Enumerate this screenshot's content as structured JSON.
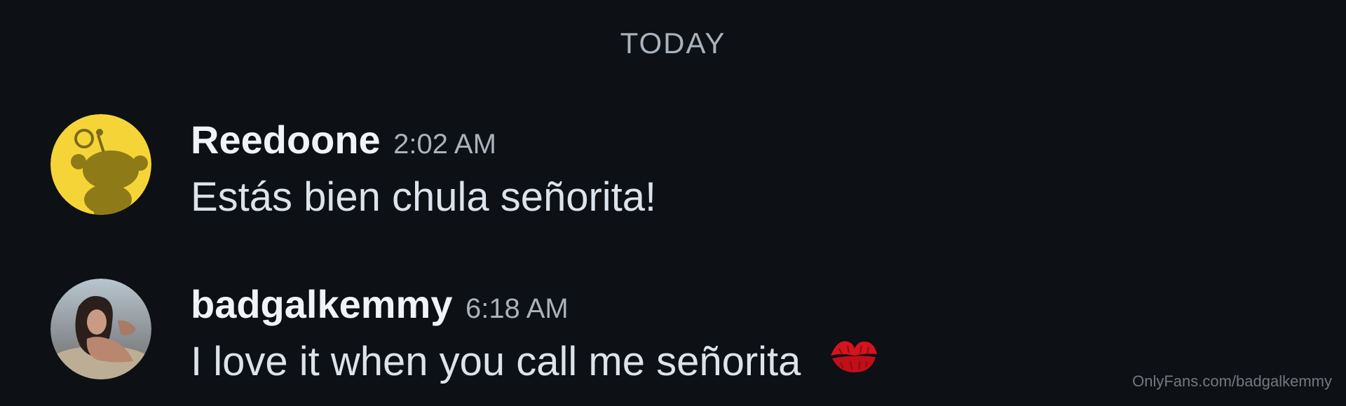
{
  "divider": {
    "label": "TODAY"
  },
  "messages": [
    {
      "username": "Reedoone",
      "time": "2:02 AM",
      "text": "Estás bien chula señorita!",
      "avatar_icon": "reddit-snoo-avatar",
      "avatar_color": "#f5d438"
    },
    {
      "username": "badgalkemmy",
      "time": "6:18 AM",
      "text": "I love it when you call me señorita",
      "avatar_icon": "profile-photo-avatar",
      "emoji": "kiss-mark-emoji"
    }
  ],
  "watermark": {
    "text": "OnlyFans.com/badgalkemmy"
  },
  "colors": {
    "background": "#0d1014",
    "username": "#f1f4f7",
    "message_text": "#dde3ea",
    "secondary_text": "#aab2bb",
    "kiss_red": "#d4141e"
  }
}
